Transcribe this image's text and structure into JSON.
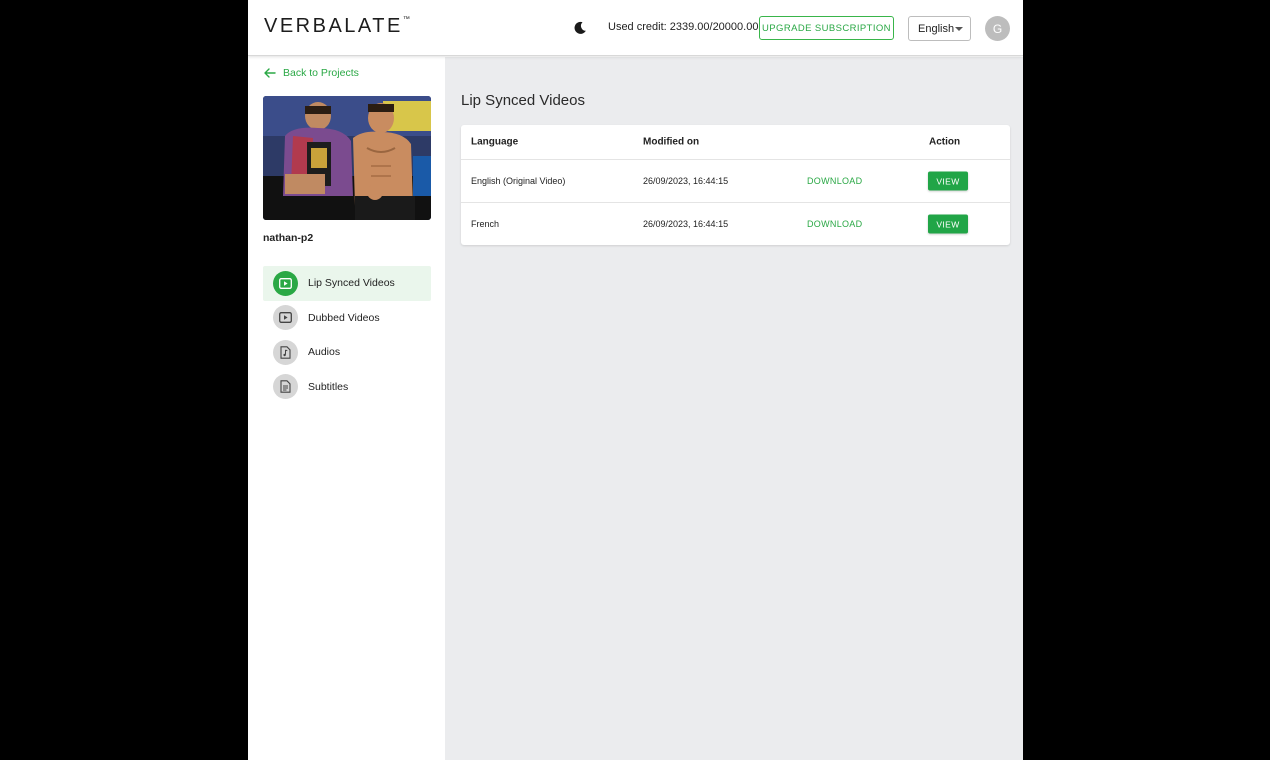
{
  "header": {
    "logo": "VERBALATE",
    "logo_tm": "™",
    "theme_icon": "moon-icon",
    "credit_text": "Used credit: 2339.00/20000.00",
    "upgrade_label": "UPGRADE SUBSCRIPTION",
    "language_selected": "English",
    "avatar_initial": "G"
  },
  "sidebar": {
    "back_label": "Back to Projects",
    "project_name": "nathan-p2",
    "items": [
      {
        "label": "Lip Synced Videos",
        "icon": "play-video-icon",
        "active": true
      },
      {
        "label": "Dubbed Videos",
        "icon": "play-video-icon",
        "active": false
      },
      {
        "label": "Audios",
        "icon": "audio-file-icon",
        "active": false
      },
      {
        "label": "Subtitles",
        "icon": "document-icon",
        "active": false
      }
    ]
  },
  "main": {
    "title": "Lip Synced Videos",
    "columns": {
      "language": "Language",
      "modified": "Modified on",
      "action": "Action"
    },
    "rows": [
      {
        "language": "English (Original Video)",
        "modified": "26/09/2023, 16:44:15",
        "download": "DOWNLOAD",
        "view": "VIEW"
      },
      {
        "language": "French",
        "modified": "26/09/2023, 16:44:15",
        "download": "DOWNLOAD",
        "view": "VIEW"
      }
    ]
  },
  "colors": {
    "accent": "#2aa845",
    "active_nav_bg": "#eaf6ec",
    "main_bg": "#ebecee"
  }
}
